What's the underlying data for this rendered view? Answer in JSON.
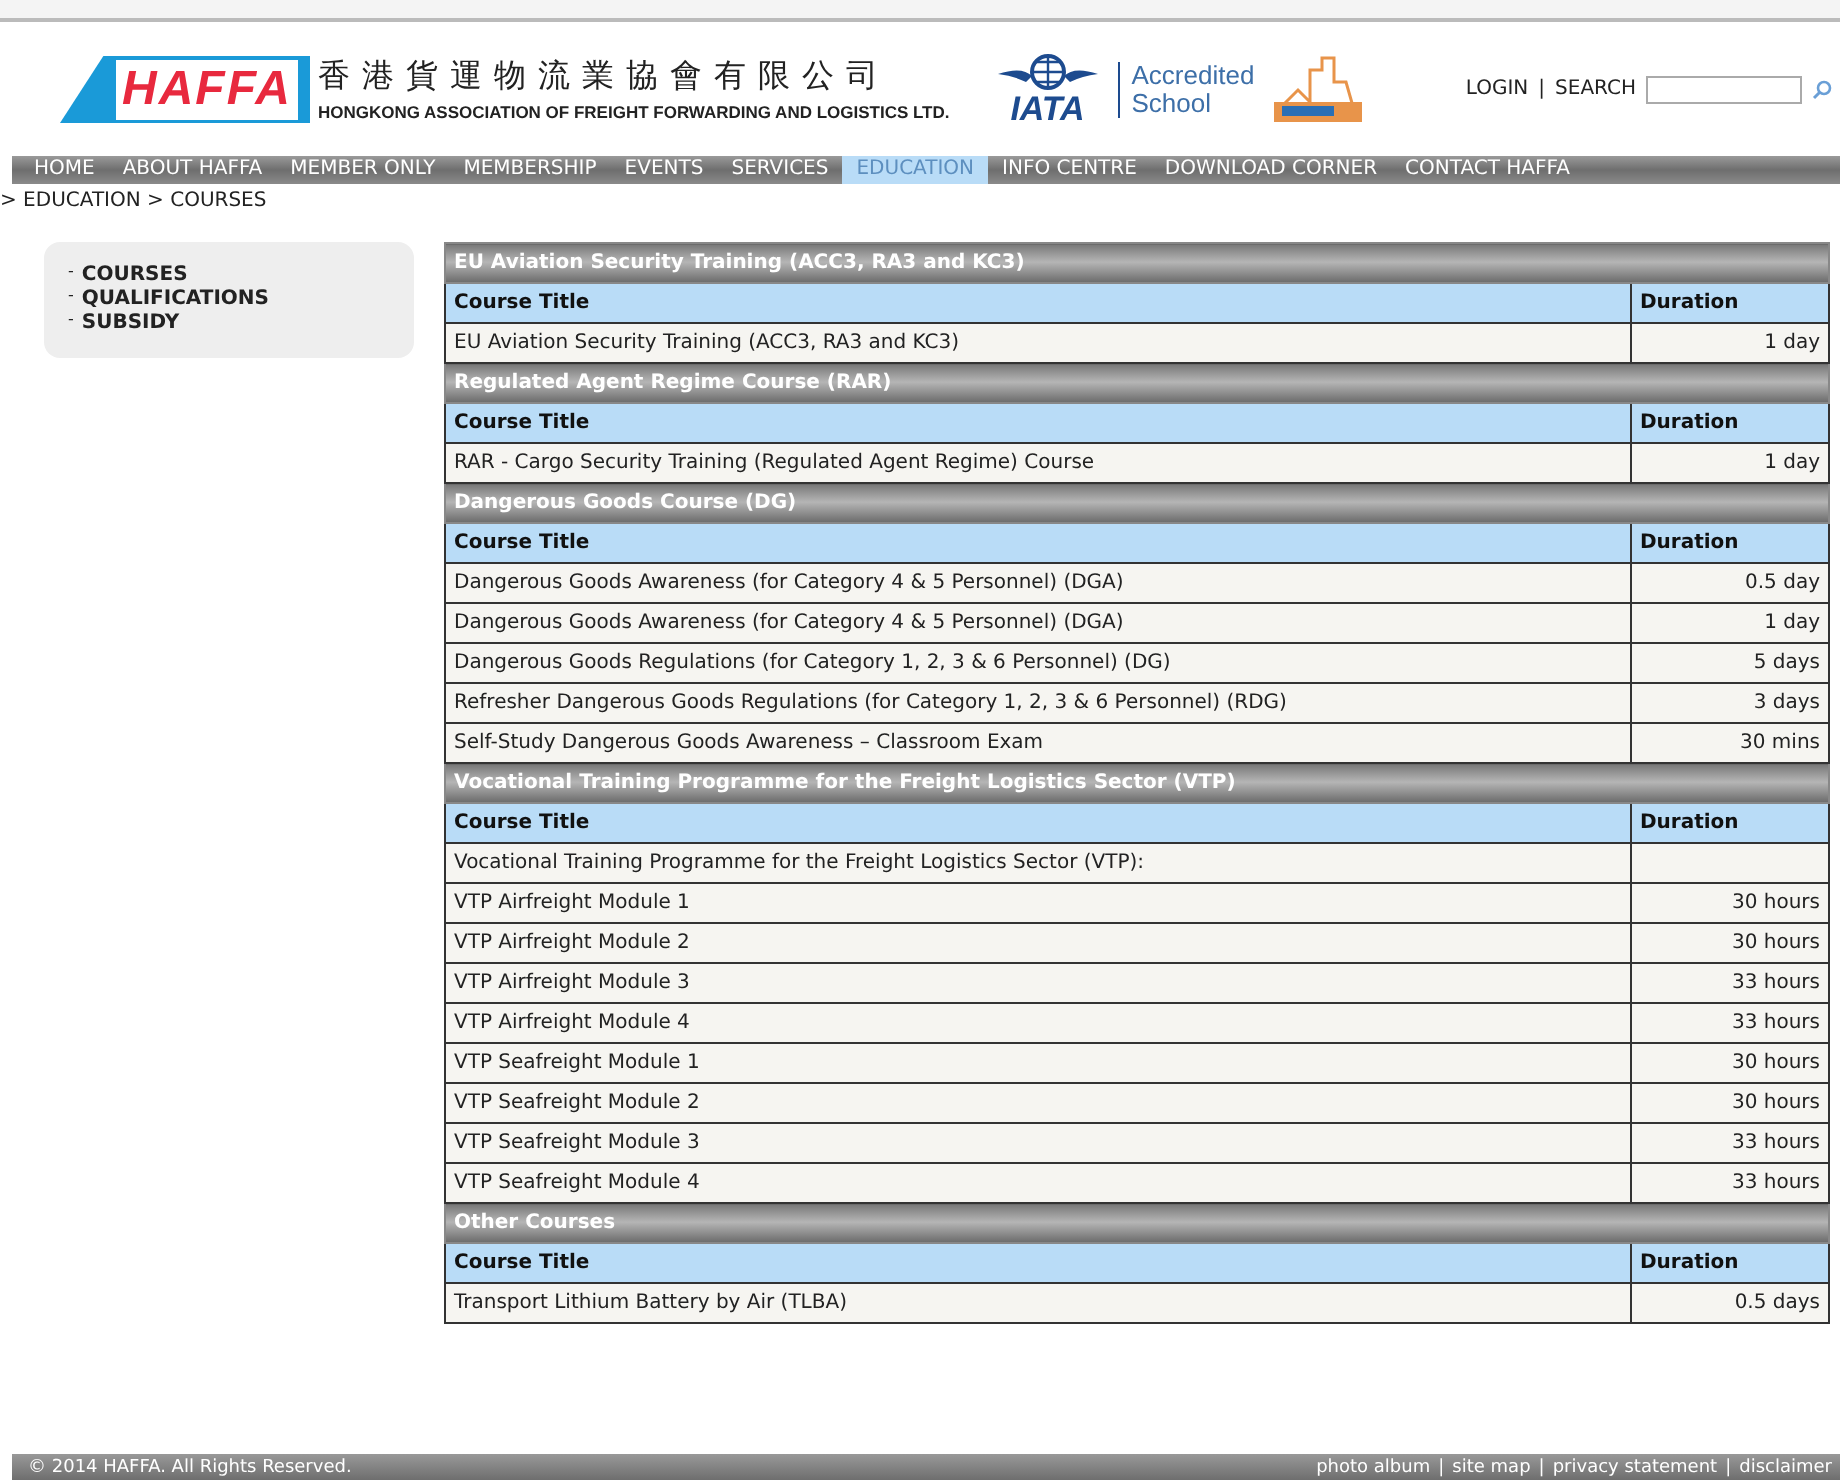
{
  "header": {
    "logo_text": "HAFFA",
    "name_zh": "香港貨運物流業協會有限公司",
    "name_en": "HONGKONG ASSOCIATION OF FREIGHT FORWARDING AND LOGISTICS LTD.",
    "iata_text": "IATA",
    "accredited": [
      "Accredited",
      "School"
    ],
    "login": "LOGIN",
    "separator": "|",
    "search_label": "SEARCH"
  },
  "nav": [
    {
      "label": "HOME",
      "selected": false
    },
    {
      "label": "ABOUT HAFFA",
      "selected": false
    },
    {
      "label": "MEMBER ONLY",
      "selected": false
    },
    {
      "label": "MEMBERSHIP",
      "selected": false
    },
    {
      "label": "EVENTS",
      "selected": false
    },
    {
      "label": "SERVICES",
      "selected": false
    },
    {
      "label": "EDUCATION",
      "selected": true
    },
    {
      "label": "INFO CENTRE",
      "selected": false
    },
    {
      "label": "DOWNLOAD CORNER",
      "selected": false
    },
    {
      "label": "CONTACT HAFFA",
      "selected": false
    }
  ],
  "breadcrumb": "> EDUCATION > COURSES",
  "sidebar": {
    "items": [
      {
        "bullet": "-",
        "label": "COURSES"
      },
      {
        "bullet": "-",
        "label": "QUALIFICATIONS"
      },
      {
        "bullet": "-",
        "label": "SUBSIDY"
      }
    ]
  },
  "sections": [
    {
      "title": "EU Aviation Security Training (ACC3, RA3 and KC3)",
      "columns": [
        "Course Title",
        "Duration"
      ],
      "rows": [
        {
          "title": "EU Aviation Security Training (ACC3, RA3 and KC3)",
          "duration": "1 day"
        }
      ]
    },
    {
      "title": "Regulated Agent Regime Course (RAR)",
      "columns": [
        "Course Title",
        "Duration"
      ],
      "rows": [
        {
          "title": "RAR - Cargo Security Training (Regulated Agent Regime) Course",
          "duration": "1 day"
        }
      ]
    },
    {
      "title": "Dangerous Goods Course (DG)",
      "columns": [
        "Course Title",
        "Duration"
      ],
      "rows": [
        {
          "title": "Dangerous Goods Awareness (for Category 4 & 5 Personnel) (DGA)",
          "duration": "0.5 day"
        },
        {
          "title": "Dangerous Goods Awareness (for Category 4 & 5 Personnel) (DGA)",
          "duration": "1 day"
        },
        {
          "title": "Dangerous Goods Regulations (for Category 1, 2, 3 & 6 Personnel) (DG)",
          "duration": "5 days"
        },
        {
          "title": "Refresher Dangerous Goods Regulations (for Category 1, 2, 3 & 6 Personnel) (RDG)",
          "duration": "3 days"
        },
        {
          "title": "Self-Study Dangerous Goods Awareness – Classroom Exam",
          "duration": "30 mins"
        }
      ]
    },
    {
      "title": "Vocational Training Programme for the Freight Logistics Sector (VTP)",
      "columns": [
        "Course Title",
        "Duration"
      ],
      "rows": [
        {
          "title": "Vocational Training Programme for the Freight Logistics Sector (VTP):"
        },
        {
          "title": "VTP Airfreight Module 1",
          "duration": "30 hours"
        },
        {
          "title": "VTP Airfreight Module 2",
          "duration": "30 hours"
        },
        {
          "title": "VTP Airfreight Module 3",
          "duration": "33 hours"
        },
        {
          "title": "VTP Airfreight Module 4",
          "duration": "33 hours"
        },
        {
          "title": "VTP Seafreight Module 1",
          "duration": "30 hours"
        },
        {
          "title": "VTP Seafreight Module 2",
          "duration": "30 hours"
        },
        {
          "title": "VTP Seafreight Module 3",
          "duration": "33 hours"
        },
        {
          "title": "VTP Seafreight Module 4",
          "duration": "33 hours"
        }
      ]
    },
    {
      "title": "Other Courses",
      "columns": [
        "Course Title",
        "Duration"
      ],
      "rows": [
        {
          "title": "Transport Lithium Battery by Air (TLBA)",
          "duration": "0.5 days"
        }
      ]
    }
  ],
  "footer": {
    "copyright": "© 2014 HAFFA. All Rights Reserved.",
    "links": [
      "photo album",
      "site map",
      "privacy statement",
      "disclaimer"
    ],
    "separator": "|"
  }
}
